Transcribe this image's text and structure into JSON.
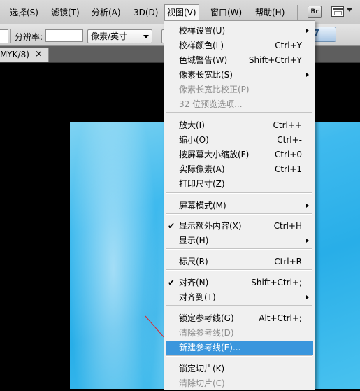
{
  "menubar": {
    "items": [
      "选择(S)",
      "滤镜(T)",
      "分析(A)",
      "3D(D)",
      "视图(V)",
      "窗口(W)",
      "帮助(H)"
    ],
    "br_label": "Br"
  },
  "options": {
    "resolution_label": "分辨率:",
    "resolution_value": "",
    "unit_value": "像素/英寸",
    "cs_label": "7"
  },
  "document_tab": {
    "title": "MYK/8)",
    "close": "×"
  },
  "view_menu": {
    "items": [
      {
        "label": "校样设置(U)",
        "shortcut": "",
        "submenu": true
      },
      {
        "label": "校样颜色(L)",
        "shortcut": "Ctrl+Y"
      },
      {
        "label": "色域警告(W)",
        "shortcut": "Shift+Ctrl+Y"
      },
      {
        "label": "像素长宽比(S)",
        "shortcut": "",
        "submenu": true
      },
      {
        "label": "像素长宽比校正(P)",
        "shortcut": "",
        "disabled": true
      },
      {
        "label": "32 位预览选项...",
        "shortcut": "",
        "disabled": true
      },
      {
        "label": "放大(I)",
        "shortcut": "Ctrl++"
      },
      {
        "label": "缩小(O)",
        "shortcut": "Ctrl+-"
      },
      {
        "label": "按屏幕大小缩放(F)",
        "shortcut": "Ctrl+0"
      },
      {
        "label": "实际像素(A)",
        "shortcut": "Ctrl+1"
      },
      {
        "label": "打印尺寸(Z)",
        "shortcut": ""
      },
      {
        "label": "屏幕模式(M)",
        "shortcut": "",
        "submenu": true
      },
      {
        "label": "显示额外内容(X)",
        "shortcut": "Ctrl+H",
        "checked": true
      },
      {
        "label": "显示(H)",
        "shortcut": "",
        "submenu": true
      },
      {
        "label": "标尺(R)",
        "shortcut": "Ctrl+R"
      },
      {
        "label": "对齐(N)",
        "shortcut": "Shift+Ctrl+;",
        "checked": true
      },
      {
        "label": "对齐到(T)",
        "shortcut": "",
        "submenu": true
      },
      {
        "label": "锁定参考线(G)",
        "shortcut": "Alt+Ctrl+;"
      },
      {
        "label": "清除参考线(D)",
        "shortcut": "",
        "disabled": true
      },
      {
        "label": "新建参考线(E)...",
        "shortcut": "",
        "highlighted": true
      },
      {
        "label": "锁定切片(K)",
        "shortcut": ""
      },
      {
        "label": "清除切片(C)",
        "shortcut": "",
        "disabled": true
      }
    ],
    "check_mark": "✔"
  },
  "colors": {
    "highlight": "#3a96dd",
    "menu_bg": "#f0f0f0",
    "arrow": "#e0262c",
    "image_blue": "#28aee8"
  }
}
